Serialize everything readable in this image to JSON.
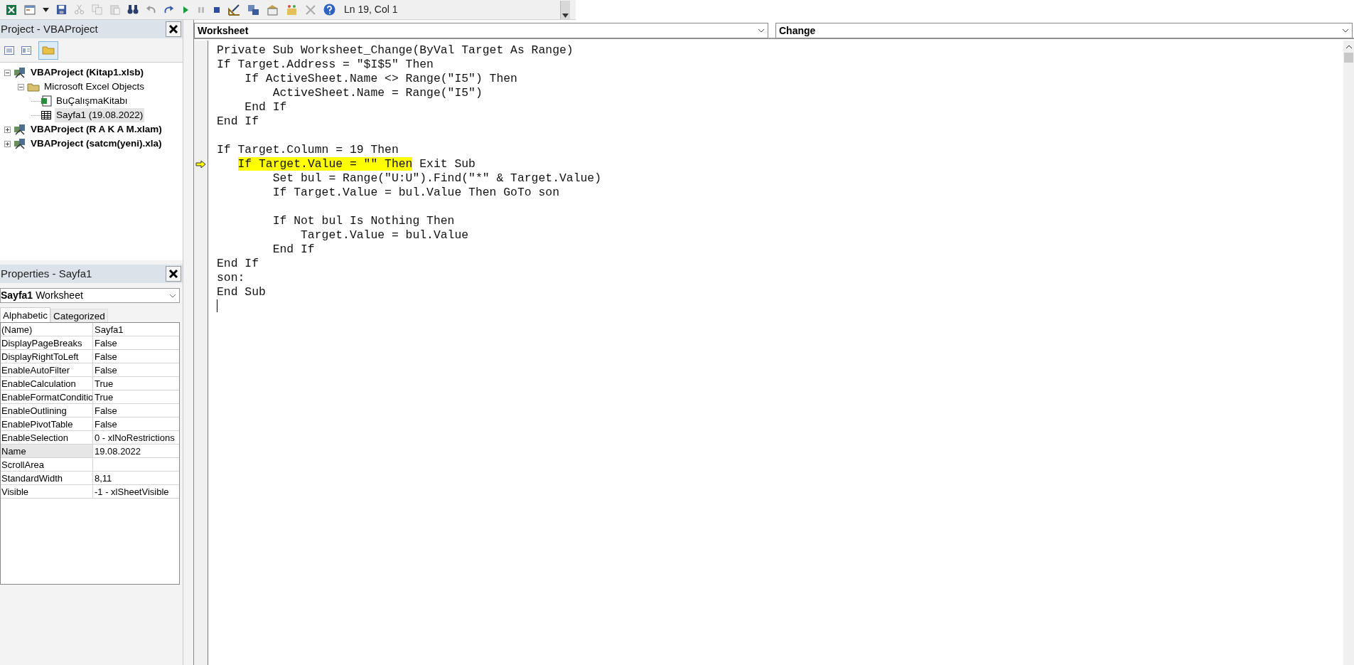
{
  "toolbar": {
    "position": "Ln 19, Col 1"
  },
  "project_explorer": {
    "title": "Project - VBAProject",
    "tree": [
      {
        "label": "VBAProject (Kitap1.xlsb)",
        "kind": "project",
        "expanded": true,
        "selected": false,
        "children": [
          {
            "label": "Microsoft Excel Objects",
            "kind": "folder",
            "expanded": true,
            "selected": false,
            "children": [
              {
                "label": "BuÇalışmaKitabı",
                "kind": "workbook",
                "selected": false
              },
              {
                "label": "Sayfa1 (19.08.2022)",
                "kind": "sheet",
                "selected": true
              }
            ]
          }
        ]
      },
      {
        "label": "VBAProject (R A K A M.xlam)",
        "kind": "project",
        "expanded": false,
        "selected": false
      },
      {
        "label": "VBAProject (satcm(yeni).xla)",
        "kind": "project",
        "expanded": false,
        "selected": false
      }
    ]
  },
  "properties": {
    "title": "Properties - Sayfa1",
    "object_name": "Sayfa1",
    "object_type": "Worksheet",
    "tabs": [
      {
        "label": "Alphabetic",
        "selected": true
      },
      {
        "label": "Categorized",
        "selected": false
      }
    ],
    "rows": [
      {
        "name": "(Name)",
        "value": "Sayfa1",
        "selected": false
      },
      {
        "name": "DisplayPageBreaks",
        "value": "False",
        "selected": false
      },
      {
        "name": "DisplayRightToLeft",
        "value": "False",
        "selected": false
      },
      {
        "name": "EnableAutoFilter",
        "value": "False",
        "selected": false
      },
      {
        "name": "EnableCalculation",
        "value": "True",
        "selected": false
      },
      {
        "name": "EnableFormatConditio",
        "value": "True",
        "selected": false
      },
      {
        "name": "EnableOutlining",
        "value": "False",
        "selected": false
      },
      {
        "name": "EnablePivotTable",
        "value": "False",
        "selected": false
      },
      {
        "name": "EnableSelection",
        "value": "0 - xlNoRestrictions",
        "selected": false
      },
      {
        "name": "Name",
        "value": "19.08.2022",
        "selected": true
      },
      {
        "name": "ScrollArea",
        "selected": false
      },
      {
        "name": "StandardWidth",
        "value": "8,11",
        "selected": false
      },
      {
        "name": "Visible",
        "value": "-1 - xlSheetVisible",
        "selected": false
      }
    ]
  },
  "code_window": {
    "object": "Worksheet",
    "procedure": "Change",
    "lines": [
      {
        "kind": "code",
        "execution_point": false,
        "segments": [
          {
            "text": "Private Sub Worksheet_Change(ByVal Target As Range)",
            "highlight": false
          }
        ]
      },
      {
        "kind": "code",
        "execution_point": false,
        "segments": [
          {
            "text": "If Target.Address = \"$I$5\" Then",
            "highlight": false
          }
        ]
      },
      {
        "kind": "code",
        "execution_point": false,
        "segments": [
          {
            "text": "    If ActiveSheet.Name <> Range(\"I5\") Then",
            "highlight": false
          }
        ]
      },
      {
        "kind": "code",
        "execution_point": false,
        "segments": [
          {
            "text": "        ActiveSheet.Name = Range(\"I5\")",
            "highlight": false
          }
        ]
      },
      {
        "kind": "code",
        "execution_point": false,
        "segments": [
          {
            "text": "    End If",
            "highlight": false
          }
        ]
      },
      {
        "kind": "code",
        "execution_point": false,
        "segments": [
          {
            "text": "End If",
            "highlight": false
          }
        ]
      },
      {
        "kind": "blank"
      },
      {
        "kind": "code",
        "execution_point": false,
        "segments": [
          {
            "text": "If Target.Column = 19 Then",
            "highlight": false
          }
        ]
      },
      {
        "kind": "code",
        "execution_point": true,
        "segments": [
          {
            "text": "   If Target.Value = \"\" Then",
            "highlight": true
          },
          {
            "text": " Exit Sub",
            "highlight": false
          }
        ]
      },
      {
        "kind": "code",
        "execution_point": false,
        "segments": [
          {
            "text": "        Set bul = Range(\"U:U\").Find(\"*\" & Target.Value)",
            "highlight": false
          }
        ]
      },
      {
        "kind": "code",
        "execution_point": false,
        "segments": [
          {
            "text": "        If Target.Value = bul.Value Then GoTo son",
            "highlight": false
          }
        ]
      },
      {
        "kind": "blank"
      },
      {
        "kind": "code",
        "execution_point": false,
        "segments": [
          {
            "text": "        If Not bul Is Nothing Then",
            "highlight": false
          }
        ]
      },
      {
        "kind": "code",
        "execution_point": false,
        "segments": [
          {
            "text": "            Target.Value = bul.Value",
            "highlight": false
          }
        ]
      },
      {
        "kind": "code",
        "execution_point": false,
        "segments": [
          {
            "text": "        End If",
            "highlight": false
          }
        ]
      },
      {
        "kind": "code",
        "execution_point": false,
        "segments": [
          {
            "text": "End If",
            "highlight": false
          }
        ]
      },
      {
        "kind": "code",
        "execution_point": false,
        "segments": [
          {
            "text": "son:",
            "highlight": false
          }
        ]
      },
      {
        "kind": "code",
        "execution_point": false,
        "segments": [
          {
            "text": "End Sub",
            "highlight": false
          }
        ]
      }
    ]
  }
}
